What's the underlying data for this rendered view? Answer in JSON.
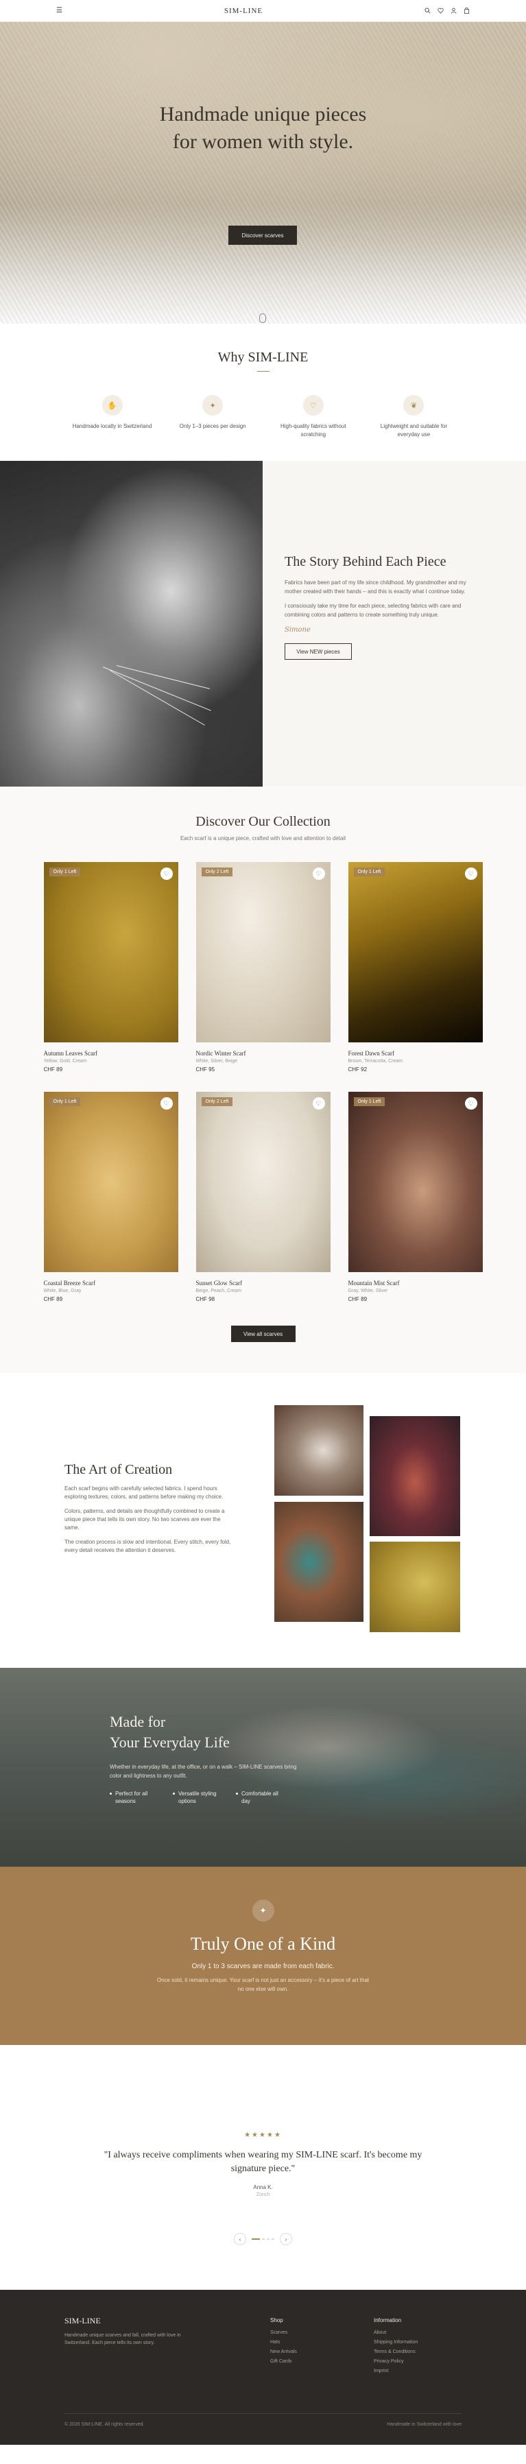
{
  "header": {
    "logo": "SIM-LINE",
    "icons": [
      "menu-icon",
      "search-icon",
      "heart-icon",
      "user-icon",
      "bag-icon"
    ]
  },
  "hero": {
    "title_line1": "Handmade unique pieces",
    "title_line2": "for women with style.",
    "cta": "Discover scarves"
  },
  "why": {
    "title": "Why SIM-LINE",
    "features": [
      {
        "icon": "hand-icon",
        "text": "Handmade locally in Switzerland"
      },
      {
        "icon": "sparkle-icon",
        "text": "Only 1–3 pieces per design"
      },
      {
        "icon": "heart-icon",
        "text": "High-quality fabrics without scratching"
      },
      {
        "icon": "leaf-icon",
        "text": "Lightweight and suitable for everyday use"
      }
    ]
  },
  "story": {
    "title": "The Story Behind Each Piece",
    "p1": "Fabrics have been part of my life since childhood. My grandmother and my mother created with their hands – and this is exactly what I continue today.",
    "p2": "I consciously take my time for each piece, selecting fabrics with care and combining colors and patterns to create something truly unique.",
    "signature": "Simone",
    "button": "View NEW pieces"
  },
  "collection": {
    "title": "Discover Our Collection",
    "subtitle": "Each scarf is a unique piece, crafted with love and attention to detail",
    "products": [
      {
        "badge": "Only 1 Left",
        "name": "Autumn Leaves Scarf",
        "color": "Yellow, Gold, Cream",
        "price": "CHF 89"
      },
      {
        "badge": "Only 2 Left",
        "name": "Nordic Winter Scarf",
        "color": "White, Silver, Beige",
        "price": "CHF 95"
      },
      {
        "badge": "Only 1 Left",
        "name": "Forest Dawn Scarf",
        "color": "Brown, Terracotta, Cream",
        "price": "CHF 92"
      },
      {
        "badge": "Only 1 Left",
        "name": "Coastal Breeze Scarf",
        "color": "White, Blue, Gray",
        "price": "CHF 89"
      },
      {
        "badge": "Only 2 Left",
        "name": "Sunset Glow Scarf",
        "color": "Beige, Peach, Cream",
        "price": "CHF 98"
      },
      {
        "badge": "Only 1 Left",
        "name": "Mountain Mist Scarf",
        "color": "Gray, White, Silver",
        "price": "CHF 89"
      }
    ],
    "view_all": "View all scarves"
  },
  "art": {
    "title": "The Art of Creation",
    "p1": "Each scarf begins with carefully selected fabrics. I spend hours exploring textures, colors, and patterns before making my choice.",
    "p2": "Colors, patterns, and details are thoughtfully combined to create a unique piece that tells its own story. No two scarves are ever the same.",
    "p3": "The creation process is slow and intentional. Every stitch, every fold, every detail receives the attention it deserves."
  },
  "everyday": {
    "title_line1": "Made for",
    "title_line2": "Your Everyday Life",
    "text": "Whether in everyday life, at the office, or on a walk – SIM-LINE scarves bring color and lightness to any outfit.",
    "bullets": [
      "Perfect for all seasons",
      "Versatile styling options",
      "Comfortable all day"
    ]
  },
  "truly": {
    "title": "Truly One of a Kind",
    "line1": "Only 1 to 3 scarves are made from each fabric.",
    "line2": "Once sold, it remains unique. Your scarf is not just an accessory – it's a piece of art that no one else will own."
  },
  "testimonial": {
    "stars": "★★★★★",
    "quote": "\"I always receive compliments when wearing my SIM-LINE scarf. It's become my signature piece.\"",
    "author": "Anna K.",
    "location": "Zürich"
  },
  "footer": {
    "brand": "SIM-LINE",
    "desc": "Handmade unique scarves and fall, crafted with love in Switzerland. Each piece tells its own story.",
    "shop_title": "Shop",
    "shop": [
      "Scarves",
      "Hats",
      "New Arrivals",
      "Gift Cards"
    ],
    "info_title": "Information",
    "info": [
      "About",
      "Shipping Information",
      "Terms & Conditions",
      "Privacy Policy",
      "Imprint"
    ],
    "copyright": "© 2026 SIM-LINE. All rights reserved.",
    "made": "Handmade in Switzerland with love"
  }
}
